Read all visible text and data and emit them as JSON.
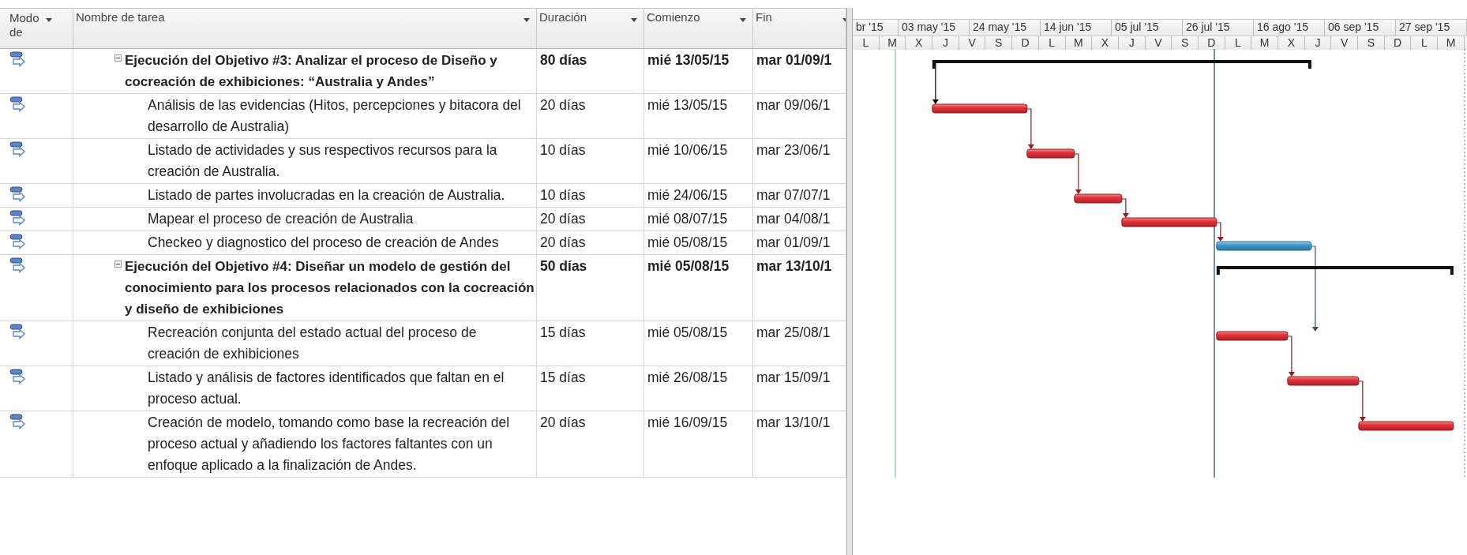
{
  "columns": [
    "Modo de",
    "Nombre de tarea",
    "Duración",
    "Comienzo",
    "Fin"
  ],
  "timescale": {
    "top": [
      "br '15",
      "03 may '15",
      "24 may '15",
      "14 jun '15",
      "05 jul '15",
      "26 jul '15",
      "16 ago '15",
      "06 sep '15",
      "27 sep '15"
    ],
    "bottom": [
      "L",
      "M",
      "X",
      "J",
      "V",
      "S",
      "D",
      "L",
      "M",
      "X",
      "J",
      "V",
      "S",
      "D",
      "L",
      "M",
      "X",
      "J",
      "V",
      "S",
      "D",
      "L",
      "M"
    ]
  },
  "tasks": [
    {
      "kind": "summary",
      "expanded": true,
      "name": "Ejecución del Objetivo #3: Analizar el proceso de Diseño y cocreación de exhibiciones: “Australia y Andes”",
      "duration": "80 días",
      "start": "mié 13/05/15",
      "finish": "mar 01/09/1"
    },
    {
      "kind": "task",
      "critical": true,
      "name": "Análisis de las evidencias (Hitos, percepciones y bitacora del desarrollo de Australia)",
      "duration": "20 días",
      "start": "mié 13/05/15",
      "finish": "mar 09/06/1"
    },
    {
      "kind": "task",
      "critical": true,
      "name": "Listado de actividades y sus respectivos recursos para la creación de Australia.",
      "duration": "10 días",
      "start": "mié 10/06/15",
      "finish": "mar 23/06/1"
    },
    {
      "kind": "task",
      "critical": true,
      "name": "Listado de partes involucradas en la creación de Australia.",
      "duration": "10 días",
      "start": "mié 24/06/15",
      "finish": "mar 07/07/1"
    },
    {
      "kind": "task",
      "critical": true,
      "name": "Mapear el proceso de creación de Australia",
      "duration": "20 días",
      "start": "mié 08/07/15",
      "finish": "mar 04/08/1"
    },
    {
      "kind": "task",
      "critical": false,
      "name": "Checkeo y diagnostico del proceso de creación de Andes",
      "duration": "20 días",
      "start": "mié 05/08/15",
      "finish": "mar 01/09/1"
    },
    {
      "kind": "summary",
      "expanded": true,
      "name": "Ejecución del Objetivo #4: Diseñar un modelo de gestión del conocimiento para los procesos relacionados con la cocreación y diseño de exhibiciones",
      "duration": "50 días",
      "start": "mié 05/08/15",
      "finish": "mar 13/10/1"
    },
    {
      "kind": "task",
      "critical": true,
      "name": "Recreación conjunta del estado actual del proceso de creación de exhibiciones",
      "duration": "15 días",
      "start": "mié 05/08/15",
      "finish": "mar 25/08/1"
    },
    {
      "kind": "task",
      "critical": true,
      "name": "Listado y análisis de factores identificados que faltan en el proceso actual.",
      "duration": "15 días",
      "start": "mié 26/08/15",
      "finish": "mar 15/09/1"
    },
    {
      "kind": "task",
      "critical": true,
      "name": "Creación de modelo, tomando como base la recreación del proceso actual y añadiendo los factores faltantes con un enfoque aplicado a la finalización de Andes.",
      "duration": "20 días",
      "start": "mié 16/09/15",
      "finish": "mar 13/10/1"
    }
  ]
}
